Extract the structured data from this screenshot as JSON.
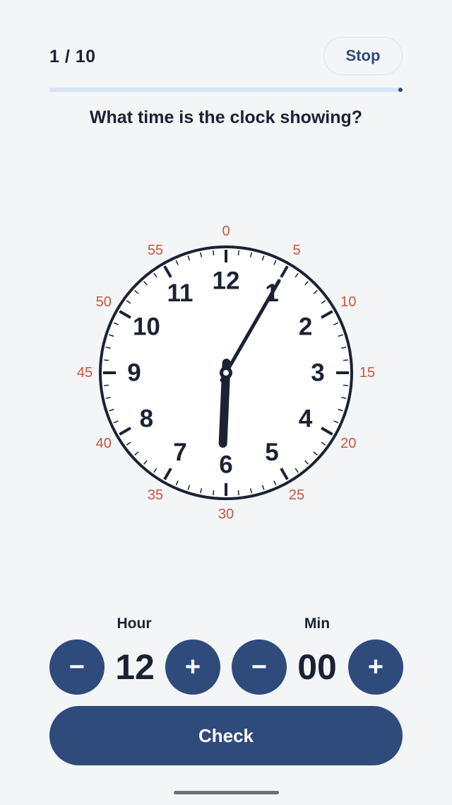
{
  "header": {
    "progress_text": "1 / 10",
    "stop_label": "Stop"
  },
  "progress": {
    "current": 1,
    "total": 10
  },
  "question": "What time is the clock showing?",
  "clock": {
    "hour_numbers": [
      "12",
      "1",
      "2",
      "3",
      "4",
      "5",
      "6",
      "7",
      "8",
      "9",
      "10",
      "11"
    ],
    "minute_labels": [
      "0",
      "5",
      "10",
      "15",
      "20",
      "25",
      "30",
      "35",
      "40",
      "45",
      "50",
      "55"
    ],
    "time_shown": {
      "hour": 6,
      "minute": 5
    },
    "colors": {
      "face": "#ffffff",
      "rim": "#1b2233",
      "numbers": "#1b2233",
      "minute_labels": "#c8553d",
      "hands": "#1b2233"
    }
  },
  "answer": {
    "hour_label": "Hour",
    "min_label": "Min",
    "hour_value": "12",
    "min_value": "00",
    "minus_symbol": "−",
    "plus_symbol": "+"
  },
  "check_label": "Check",
  "colors": {
    "accent": "#2f4b7c",
    "background": "#f3f5f7",
    "text": "#1b2233"
  }
}
